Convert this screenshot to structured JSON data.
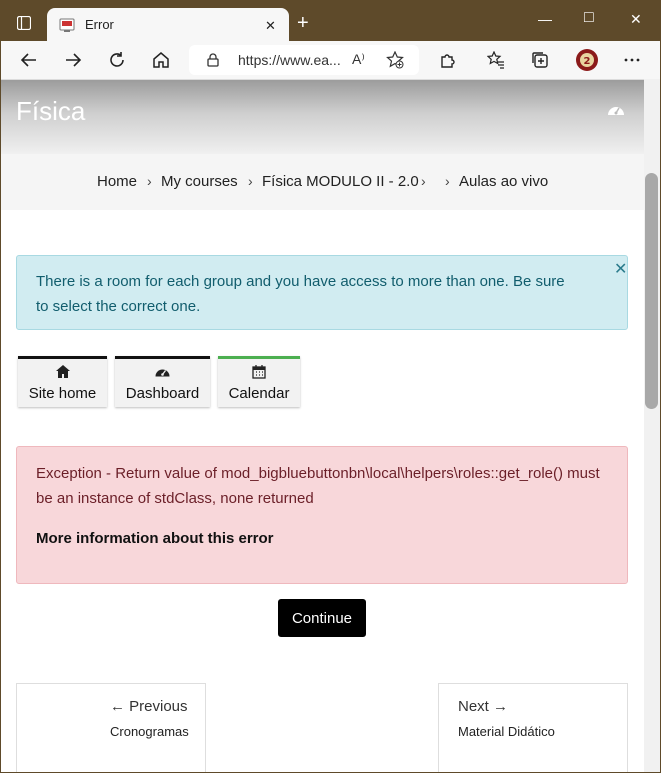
{
  "browser": {
    "tab_title": "Error",
    "tab_close": "✕",
    "new_tab": "+",
    "url": "https://www.ea...",
    "read_aloud": "A⁾",
    "minimize": "—",
    "maximize": "□",
    "close": "✕"
  },
  "header": {
    "course_title": "Física"
  },
  "breadcrumb": {
    "items": [
      "Home",
      "My courses",
      "Física MODULO II - 2.0",
      "Aulas ao vivo"
    ],
    "separator": "›"
  },
  "info_alert": {
    "message": "There is a room for each group and you have access to more than one. Be sure to select the correct one.",
    "close": "✕"
  },
  "nav_buttons": [
    {
      "label": "Site home",
      "icon": "home-icon",
      "accent": "#111111"
    },
    {
      "label": "Dashboard",
      "icon": "dashboard-icon",
      "accent": "#111111"
    },
    {
      "label": "Calendar",
      "icon": "calendar-icon",
      "accent": "#4caf50"
    }
  ],
  "error_alert": {
    "message": "Exception - Return value of mod_bigbluebuttonbn\\local\\helpers\\roles::get_role() must be an instance of stdClass, none returned",
    "more_info": "More information about this error"
  },
  "continue_label": "Continue",
  "prev": {
    "label": "← Previous",
    "name": "Cronogramas"
  },
  "next": {
    "label": "Next →",
    "name": "Material Didático"
  },
  "colors": {
    "frame": "#5e4a2a",
    "info_bg": "#d1ecf1",
    "error_bg": "#f8d7da",
    "button_dark": "#000000",
    "calendar_accent": "#4caf50"
  }
}
